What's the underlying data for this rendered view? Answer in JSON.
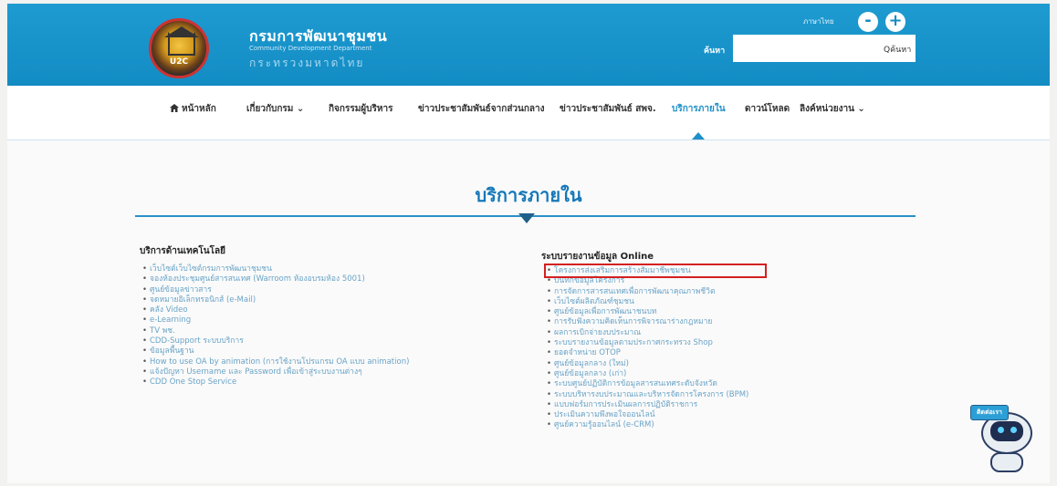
{
  "header": {
    "org_name_th": "กรมการพัฒนาชุมชน",
    "org_name_en": "Community Development Department",
    "ministry": "กระทรวงมหาดไทย",
    "lang_label": "ภาษาไทย",
    "zoom_out": "-",
    "zoom_in": "+",
    "search_label": "ค้นหา",
    "search_placeholder": "",
    "search_button": "Qค้นหา",
    "logo_text": "U2C"
  },
  "nav": {
    "items": [
      {
        "label": "หน้าหลัก"
      },
      {
        "label": "เกี่ยวกับกรม ⌄"
      },
      {
        "label": "กิจกรรมผู้บริหาร"
      },
      {
        "label": "ข่าวประชาสัมพันธ์จากส่วนกลาง"
      },
      {
        "label": "ข่าวประชาสัมพันธ์ สพจ."
      },
      {
        "label": "บริการภายใน"
      },
      {
        "label": "ดาวน์โหลด"
      },
      {
        "label": "ลิงค์หน่วยงาน ⌄"
      }
    ],
    "active_index": 5
  },
  "main": {
    "title": "บริการภายใน",
    "left_column": {
      "heading": "บริการด้านเทคโนโลยี",
      "items": [
        "เว็บไซต์เว็บไซต์กรมการพัฒนาชุมชน",
        "จองห้องประชุมศูนย์สารสนเทศ (Warroom ห้องอบรมห้อง 5001)",
        "ศูนย์ข้อมูลข่าวสาร",
        "จดหมายอิเล็กทรอนิกส์ (e-Mail)",
        "คลัง Video",
        "e-Learning",
        "TV พช.",
        "CDD-Support ระบบบริการ",
        "ข้อมูลพื้นฐาน",
        "How to use OA by animation (การใช้งานโปรแกรม OA แบบ animation)",
        "แจ้งปัญหา Username และ Password เพื่อเข้าสู่ระบบงานต่างๆ",
        "CDD One Stop Service"
      ]
    },
    "right_column": {
      "heading": "ระบบรายงานข้อมูล Online",
      "items": [
        "โครงการส่งเสริมการสร้างสัมมาชีพชุมชน",
        "บันทึกข้อมูลโครงการ",
        "การจัดการสารสนเทศเพื่อการพัฒนาคุณภาพชีวิต",
        "เว็บไซต์ผลิตภัณฑ์ชุมชน",
        "ศูนย์ข้อมูลเพื่อการพัฒนาชนบท",
        "การรับฟังความคิดเห็นการพิจารณาร่างกฎหมาย",
        "ผลการเบิกจ่ายงบประมาณ",
        "ระบบรายงานข้อมูลตามประกาศกระทรวง Shop",
        "ยอดจำหน่าย OTOP",
        "ศูนย์ข้อมูลกลาง (ใหม่)",
        "ศูนย์ข้อมูลกลาง (เก่า)",
        "ระบบศูนย์ปฏิบัติการข้อมูลสารสนเทศระดับจังหวัด",
        "ระบบบริหารงบประมาณและบริหารจัดการโครงการ (BPM)",
        "แบบฟอร์มการประเมินผลการปฏิบัติราชการ",
        "ประเมินความพึงพอใจออนไลน์",
        "ศูนย์ความรู้ออนไลน์ (e-CRM)"
      ],
      "highlighted_index": 0
    }
  },
  "mascot": {
    "badge": "ติดต่อเรา"
  },
  "colors": {
    "header_bg": "#138cc4",
    "accent": "#1e8fc8",
    "title": "#1678b8",
    "highlight_border": "#d42020",
    "link": "#6aa4c7"
  }
}
